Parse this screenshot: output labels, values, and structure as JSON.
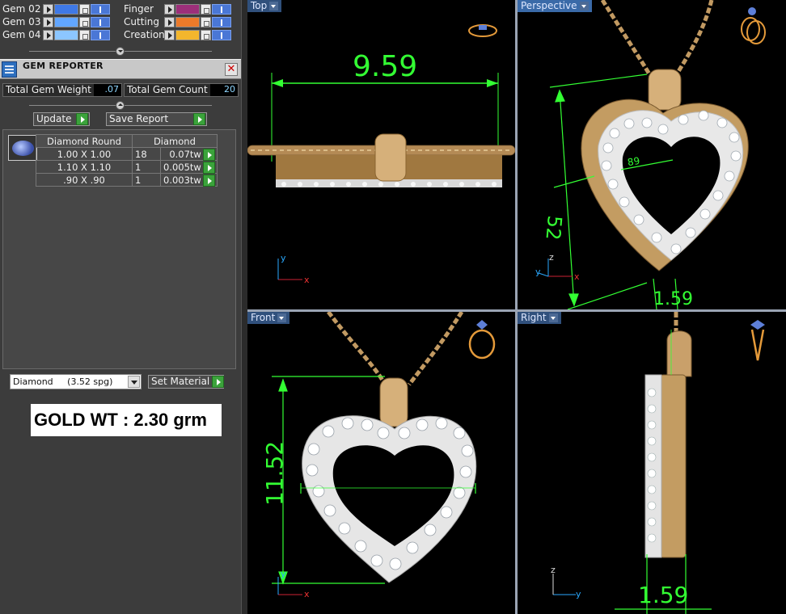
{
  "layers": [
    {
      "label": "Gem 02",
      "color": "#3f79e6"
    },
    {
      "label": "Gem 03",
      "color": "#62a6ff"
    },
    {
      "label": "Gem 04",
      "color": "#8cc6ff"
    }
  ],
  "layers_right": [
    {
      "label": "Finger",
      "color": "#9c2f7a"
    },
    {
      "label": "Cutting",
      "color": "#ec7a2a"
    },
    {
      "label": "Creation",
      "color": "#f3b62d"
    }
  ],
  "gem_reporter": {
    "title": "GEM REPORTER",
    "close": "✕",
    "total_weight_label": "Total Gem Weight",
    "total_weight_value": ".07",
    "total_count_label": "Total Gem Count",
    "total_count_value": "20",
    "update_label": "Update",
    "save_report_label": "Save Report",
    "table": {
      "headers": [
        "Diamond Round",
        "Diamond"
      ],
      "rows": [
        {
          "size": "1.00 X 1.00",
          "count": "18",
          "weight": "0.07tw"
        },
        {
          "size": "1.10 X 1.10",
          "count": "1",
          "weight": "0.005tw"
        },
        {
          "size": ".90 X .90",
          "count": "1",
          "weight": "0.003tw"
        }
      ]
    },
    "material_value": "Diamond     (3.52 spg)",
    "set_material_label": "Set Material"
  },
  "gold_weight_text": "GOLD WT : 2.30 grm",
  "viewports": {
    "top": {
      "label": "Top",
      "dimension": "9.59"
    },
    "perspective": {
      "label": "Perspective",
      "dim_a": "52",
      "dim_b": "1.59",
      "dim_c": "89"
    },
    "front": {
      "label": "Front",
      "dimension": "11.52"
    },
    "right": {
      "label": "Right",
      "dimension": "1.59"
    }
  },
  "axes": {
    "x": "x",
    "y": "y",
    "z": "z"
  },
  "colors": {
    "dimension_green": "#33ff33",
    "gold": "#d9b27a",
    "viewport_bg": "#000000",
    "panel_bg": "#3c3c3c"
  }
}
